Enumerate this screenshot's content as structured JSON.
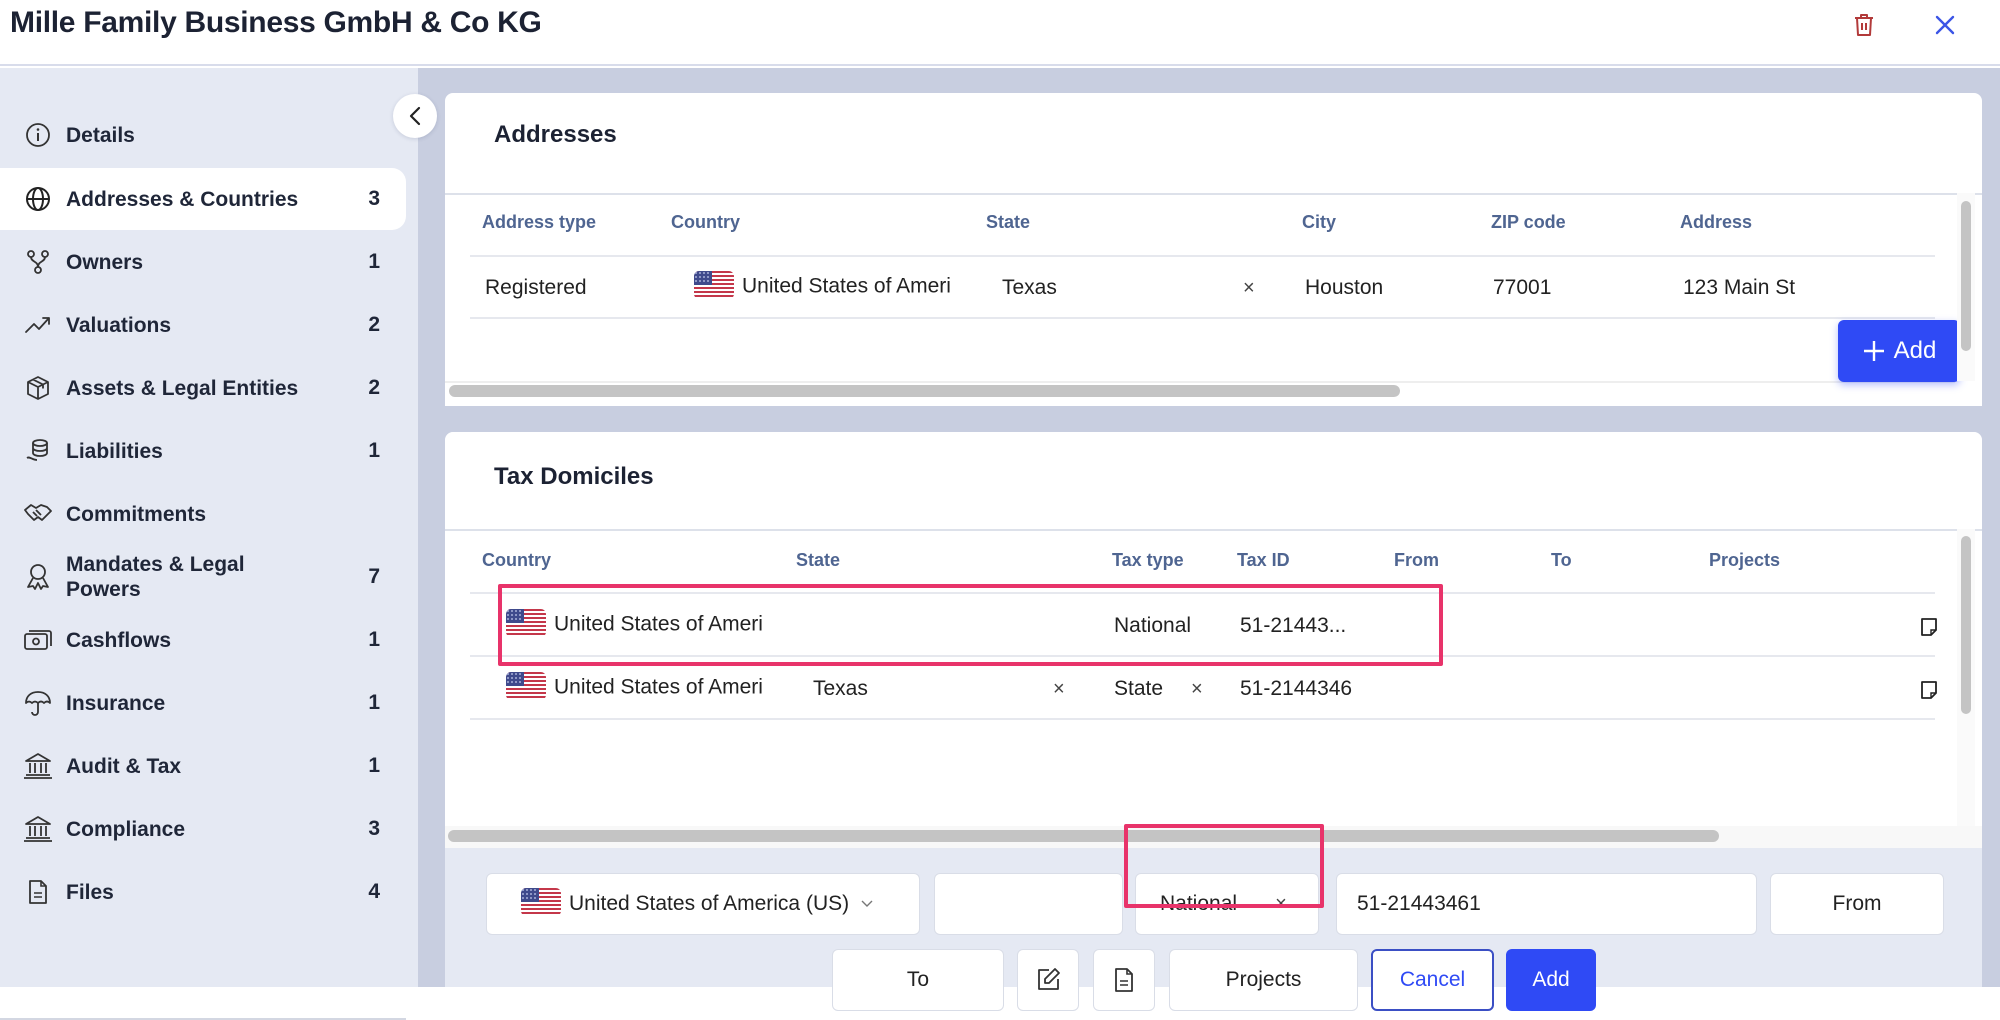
{
  "header": {
    "title": "Mille Family Business GmbH & Co KG",
    "delete_icon": "trash-icon",
    "close_icon": "close-icon"
  },
  "sidebar": {
    "collapse_icon": "chevron-left-icon",
    "items": [
      {
        "label": "Details",
        "count": "",
        "icon": "info-icon",
        "active": false
      },
      {
        "label": "Addresses & Countries",
        "count": "3",
        "icon": "globe-icon",
        "active": true
      },
      {
        "label": "Owners",
        "count": "1",
        "icon": "hierarchy-icon",
        "active": false
      },
      {
        "label": "Valuations",
        "count": "2",
        "icon": "trend-up-icon",
        "active": false
      },
      {
        "label": "Assets & Legal Entities",
        "count": "2",
        "icon": "package-icon",
        "active": false
      },
      {
        "label": "Liabilities",
        "count": "1",
        "icon": "coins-hand-icon",
        "active": false
      },
      {
        "label": "Commitments",
        "count": "",
        "icon": "handshake-icon",
        "active": false
      },
      {
        "label": "Mandates & Legal Powers",
        "count": "7",
        "icon": "award-icon",
        "active": false
      },
      {
        "label": "Cashflows",
        "count": "1",
        "icon": "cash-icon",
        "active": false
      },
      {
        "label": "Insurance",
        "count": "1",
        "icon": "umbrella-icon",
        "active": false
      },
      {
        "label": "Audit & Tax",
        "count": "1",
        "icon": "bank-icon",
        "active": false
      },
      {
        "label": "Compliance",
        "count": "3",
        "icon": "bank-icon",
        "active": false
      },
      {
        "label": "Files",
        "count": "4",
        "icon": "file-icon",
        "active": false
      }
    ]
  },
  "addresses": {
    "title": "Addresses",
    "columns": [
      "Address type",
      "Country",
      "State",
      "City",
      "ZIP code",
      "Address"
    ],
    "rows": [
      {
        "address_type": "Registered",
        "country": "United States of Ameri",
        "state": "Texas",
        "city": "Houston",
        "zip": "77001",
        "address": "123 Main St"
      }
    ],
    "add_label": "Add"
  },
  "tax_domiciles": {
    "title": "Tax Domiciles",
    "columns": [
      "Country",
      "State",
      "Tax type",
      "Tax ID",
      "From",
      "To",
      "Projects"
    ],
    "rows": [
      {
        "country": "United States of Ameri",
        "state": "",
        "tax_type": "National",
        "tax_id": "51-21443...",
        "from": "",
        "to": "",
        "projects": ""
      },
      {
        "country": "United States of Ameri",
        "state": "Texas",
        "tax_type": "State",
        "tax_id": "51-2144346",
        "from": "",
        "to": "",
        "projects": ""
      }
    ],
    "form": {
      "country": "United States of America (US)",
      "state": "",
      "tax_type": "National",
      "tax_id": "51-21443461",
      "from_placeholder": "From",
      "to_placeholder": "To",
      "projects_placeholder": "Projects",
      "cancel_label": "Cancel",
      "add_label": "Add"
    }
  },
  "colors": {
    "accent": "#2f4af5",
    "highlight": "#e8336a",
    "danger": "#b23a3a",
    "header_text": "#4f6591"
  }
}
